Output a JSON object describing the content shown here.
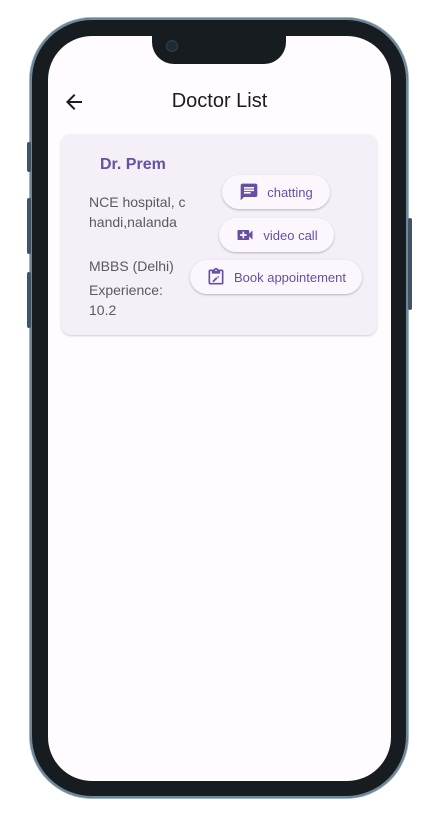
{
  "appbar": {
    "title": "Doctor List",
    "back_icon": "arrow-back-icon"
  },
  "doctor": {
    "name": "Dr. Prem",
    "address": "NCE hospital, chandi,nalanda",
    "degree": "MBBS (Delhi)",
    "experience": "Experience: 10.2"
  },
  "actions": {
    "chat_label": "chatting",
    "video_label": "video call",
    "book_label": "Book appointement"
  },
  "colors": {
    "accent": "#6750a4",
    "card_bg": "#f5eff7",
    "screen_bg": "#fffbff"
  }
}
